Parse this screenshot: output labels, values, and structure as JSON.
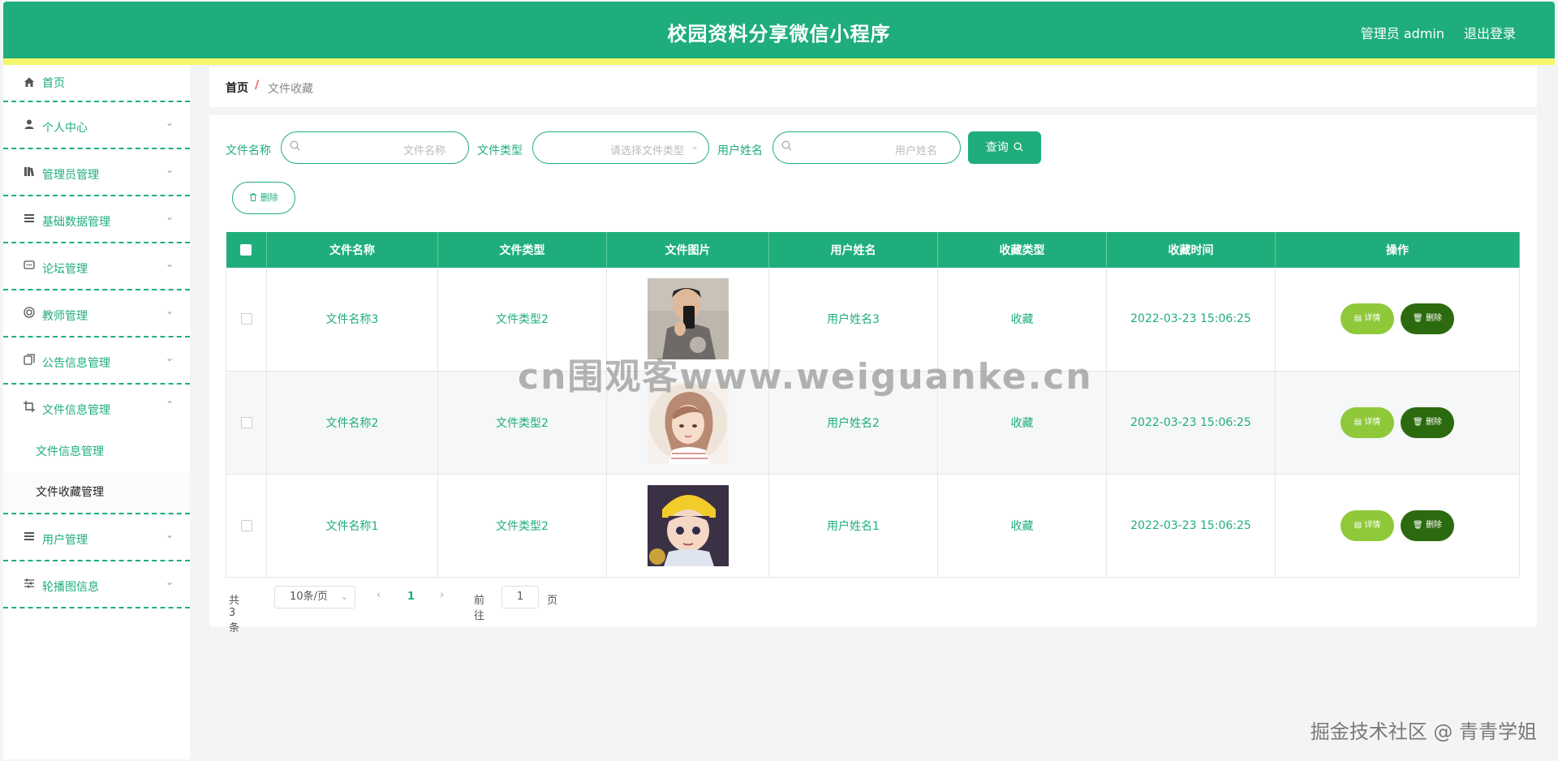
{
  "header": {
    "title": "校园资料分享微信小程序",
    "user": "管理员 admin",
    "logout": "退出登录"
  },
  "sidebar": {
    "items": [
      {
        "label": "首页",
        "icon": "home-icon"
      },
      {
        "label": "个人中心",
        "icon": "user-icon"
      },
      {
        "label": "管理员管理",
        "icon": "books-icon"
      },
      {
        "label": "基础数据管理",
        "icon": "list-icon"
      },
      {
        "label": "论坛管理",
        "icon": "chat-icon"
      },
      {
        "label": "教师管理",
        "icon": "target-icon"
      },
      {
        "label": "公告信息管理",
        "icon": "copy-icon"
      },
      {
        "label": "文件信息管理",
        "icon": "crop-icon"
      },
      {
        "label": "用户管理",
        "icon": "list-icon"
      },
      {
        "label": "轮播图信息",
        "icon": "sliders-icon"
      }
    ],
    "submenu": [
      "文件信息管理",
      "文件收藏管理"
    ]
  },
  "breadcrumb": {
    "home": "首页",
    "sep": "/",
    "current": "文件收藏"
  },
  "filters": {
    "name_label": "文件名称",
    "name_placeholder": "文件名称",
    "type_label": "文件类型",
    "type_placeholder": "请选择文件类型",
    "user_label": "用户姓名",
    "user_placeholder": "用户姓名",
    "query_button": "查询"
  },
  "actions": {
    "delete": "删除"
  },
  "table": {
    "columns": [
      "文件名称",
      "文件类型",
      "文件图片",
      "用户姓名",
      "收藏类型",
      "收藏时间",
      "操作"
    ],
    "rows": [
      {
        "name": "文件名称3",
        "type": "文件类型2",
        "user": "用户姓名3",
        "fav_type": "收藏",
        "time": "2022-03-23 15:06:25"
      },
      {
        "name": "文件名称2",
        "type": "文件类型2",
        "user": "用户姓名2",
        "fav_type": "收藏",
        "time": "2022-03-23 15:06:25"
      },
      {
        "name": "文件名称1",
        "type": "文件类型2",
        "user": "用户姓名1",
        "fav_type": "收藏",
        "time": "2022-03-23 15:06:25"
      }
    ],
    "detail_button": "详情",
    "delete_button": "删除"
  },
  "pagination": {
    "total": "共 3 条",
    "page_size": "10条/页",
    "current": "1",
    "goto": "前往",
    "jump_value": "1",
    "page_suffix": "页"
  },
  "watermarks": {
    "center": "cn围观客www.weiguanke.cn",
    "corner": "掘金技术社区 @ 青青学姐"
  },
  "colors": {
    "primary": "#1fae7b",
    "strip": "#f4f76a",
    "detail": "#8fc93a",
    "delete": "#2c6a0f"
  }
}
